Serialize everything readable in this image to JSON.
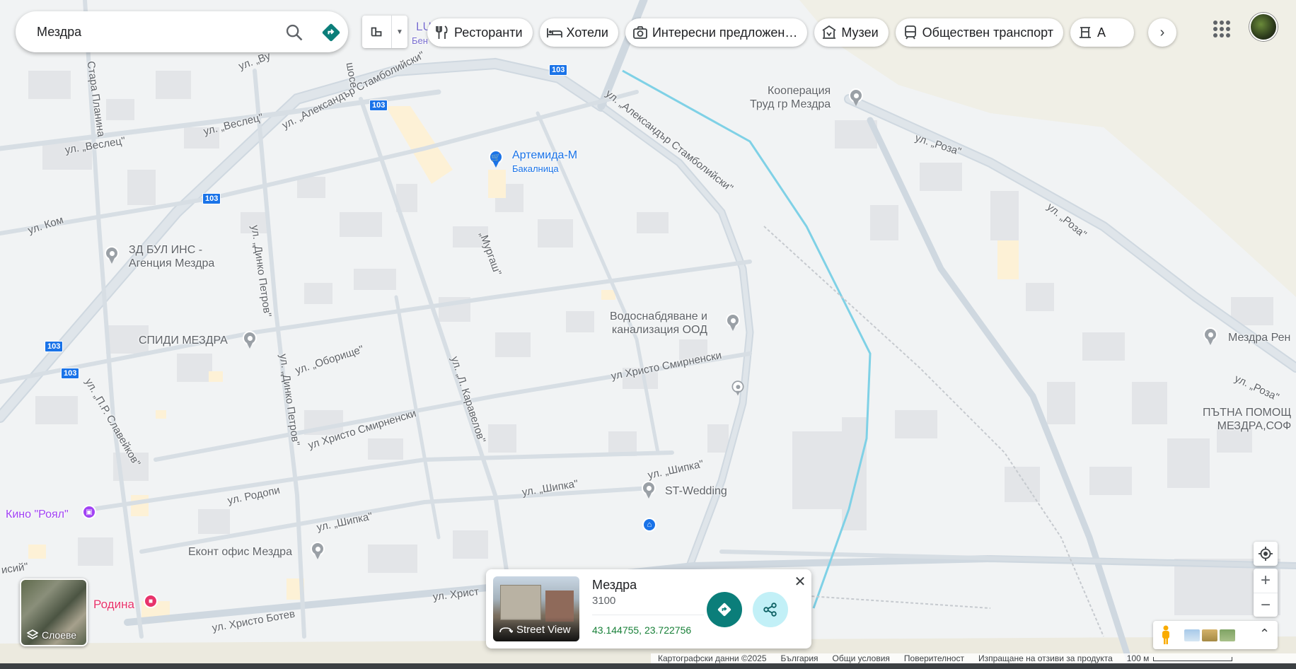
{
  "search": {
    "value": "Мездра",
    "placeholder": ""
  },
  "layer_menu": {
    "icon": "transit-layer-icon"
  },
  "chips": [
    {
      "label": "Ресторанти",
      "icon": "restaurant-icon"
    },
    {
      "label": "Хотели",
      "icon": "hotel-icon"
    },
    {
      "label": "Интересни предложен…",
      "icon": "camera-icon"
    },
    {
      "label": "Музеи",
      "icon": "museum-icon"
    },
    {
      "label": "Обществен транспорт",
      "icon": "transit-icon"
    },
    {
      "label": "А",
      "icon": "attraction-icon"
    }
  ],
  "map": {
    "places": {
      "cooperation": "Кооперация\nТруд гр Мездра",
      "artemida": "Артемида-М",
      "artemida_sub": "Бакалница",
      "zd_bul": "ЗД БУЛ ИНС -\nАгенция Мездра",
      "speedy": "СПИДИ МЕЗДРА",
      "vodosnabdyavane": "Водоснабдяване и\nканализация ООД",
      "st_wedding": "ST-Wedding",
      "kino": "Кино \"Роял\"",
      "ekont": "Еконт офис Мездра",
      "rodina": "Родина",
      "mezdra_ren": "Мездра Рен",
      "patna": "ПЪТНА ПОМОЩ\nМЕЗДРА,СОФ",
      "lu_partial": "LU",
      "ben_partial": "Бен"
    },
    "streets": {
      "stamboliyski1": "ул. „Александър Стамболийски\"",
      "stamboliyski2": "ул. „Александър Стамболийски\"",
      "veslets1": "ул. „Веслец\"",
      "veslets2": "ул. „Веслец\"",
      "kom": "ул. Ком",
      "dinko1": "ул. „Динко Петров\"",
      "dinko2": "ул. „Динко Петров\"",
      "murgash": "„Мургаш\"",
      "oborishte": "ул. „Оборище\"",
      "karavelov": "ул. „Л. Каравелов\"",
      "smirnenski1": "ул Христо Смирненски",
      "smirnenski2": "ул Христо Смирненски",
      "slaveykov": "ул. „П.Р. Славейков\"",
      "rodopi": "ул. Родопи",
      "shipka1": "ул. „Шипка\"",
      "shipka2": "ул. „Шипка\"",
      "shipka3": "ул. „Шипка\"",
      "hristo_botev": "ул. Христо Ботев",
      "hrist_partial": "ул. Христ",
      "roza1": "ул. „Роза\"",
      "roza2": "ул. „Роза\"",
      "roza3": "ул. „Роза\"",
      "stara_planina": "Стара Планина",
      "shose": "шосе",
      "isiy": "исий\"",
      "vu": "ул. „Ву"
    },
    "shields": [
      "103",
      "103",
      "103",
      "103",
      "103"
    ]
  },
  "card": {
    "title": "Мездра",
    "postal": "3100",
    "coords": "43.144755, 23.722756",
    "street_view_label": "Street View"
  },
  "layers_label": "Слоеве",
  "footer": {
    "map_data": "Картографски данни ©2025",
    "country": "България",
    "terms": "Общи условия",
    "privacy": "Поверителност",
    "feedback": "Изпращане на отзиви за продукта",
    "scale": "100 м"
  }
}
